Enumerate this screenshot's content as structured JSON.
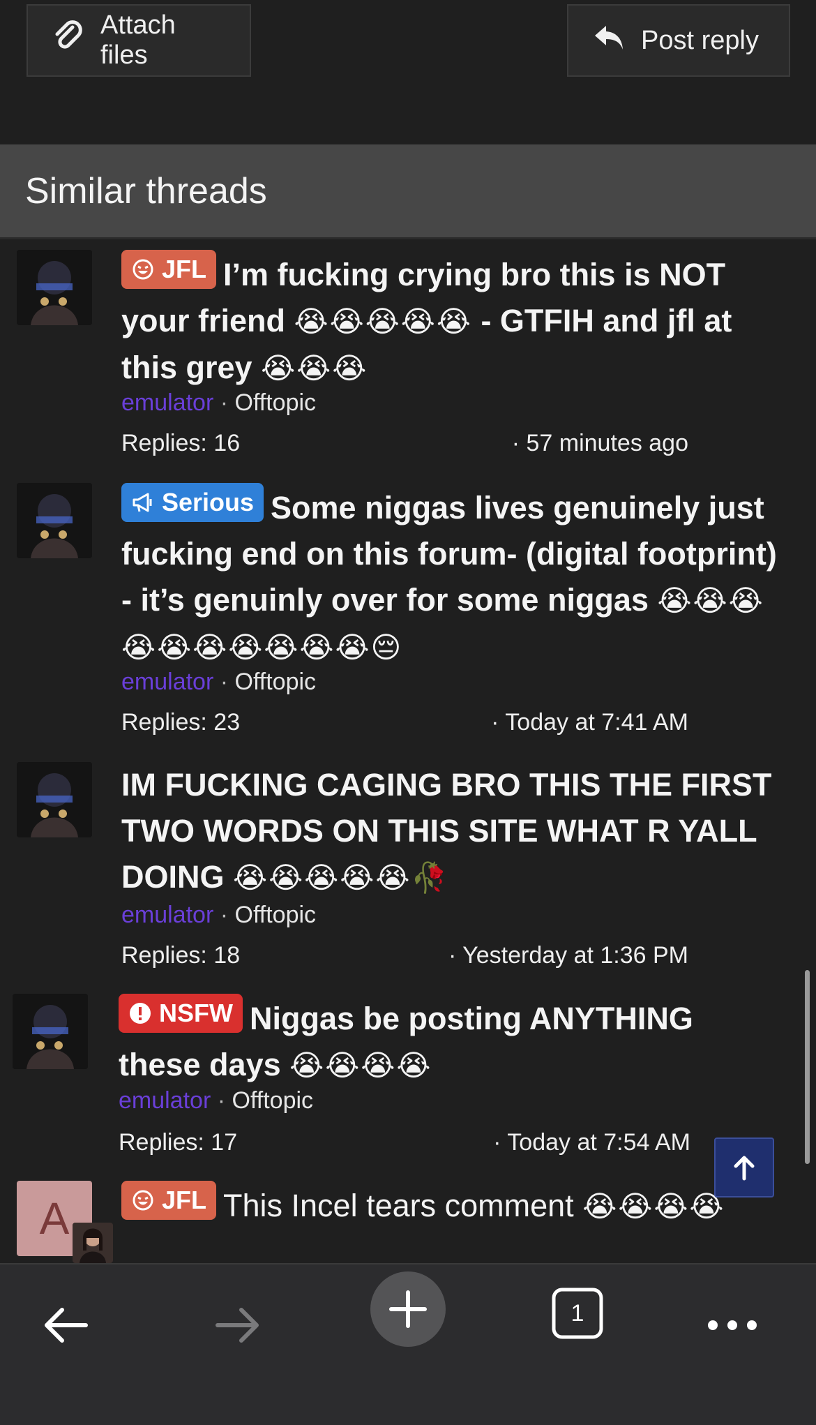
{
  "actions": {
    "attach_label": "Attach files",
    "reply_label": "Post reply"
  },
  "section": {
    "title": "Similar threads"
  },
  "threads": [
    {
      "prefix": "JFL",
      "prefix_color": "#d7634b",
      "title": "I’m fucking crying bro this is NOT your friend",
      "emojis_a": "😭😭😭😭😭",
      "title_b": " - GTFIH and jfl at this grey ",
      "emojis_b": "😭😭😭",
      "author": "emulator",
      "forum": "Offtopic",
      "replies": "Replies: 16",
      "time": "· 57 minutes ago"
    },
    {
      "prefix": "Serious",
      "prefix_color": "#2f80d8",
      "title": "Some niggas lives genuinely just fucking end on this forum- (digital footprint) - it’s genuinly over for some niggas ",
      "emojis": "😭😭😭😭😭😭😭😭😭😭😔",
      "author": "emulator",
      "forum": "Offtopic",
      "replies": "Replies: 23",
      "time": "· Today at 7:41 AM"
    },
    {
      "title": "IM FUCKING CAGING BRO THIS THE FIRST TWO WORDS ON THIS SITE WHAT R YALL DOING ",
      "emojis": "😭😭😭😭😭🥀",
      "author": "emulator",
      "forum": "Offtopic",
      "replies": "Replies: 18",
      "time": "· Yesterday at 1:36 PM"
    },
    {
      "prefix": "NSFW",
      "prefix_color": "#d9302e",
      "title": "Niggas be posting ANYTHING these days ",
      "emojis": "😭😭😭😭",
      "author": "emulator",
      "forum": "Offtopic",
      "replies": "Replies: 17",
      "time": "· Today at 7:54 AM"
    },
    {
      "prefix": "JFL",
      "prefix_color": "#d7634b",
      "avatar_letter": "A",
      "title": "This Incel tears comment ",
      "emojis": "😭😭😭😭"
    }
  ],
  "toolbar": {
    "tab_count": "1"
  },
  "icons": {
    "attach": "paperclip-icon",
    "reply": "reply-arrow-icon",
    "jfl": "laughing-face-icon",
    "serious": "megaphone-icon",
    "nsfw": "exclamation-circle-icon",
    "back": "arrow-left-icon",
    "forward": "arrow-right-icon",
    "new_tab": "plus-icon",
    "tabs": "tabs-icon",
    "more": "more-icon",
    "scroll_top": "arrow-up-icon"
  }
}
